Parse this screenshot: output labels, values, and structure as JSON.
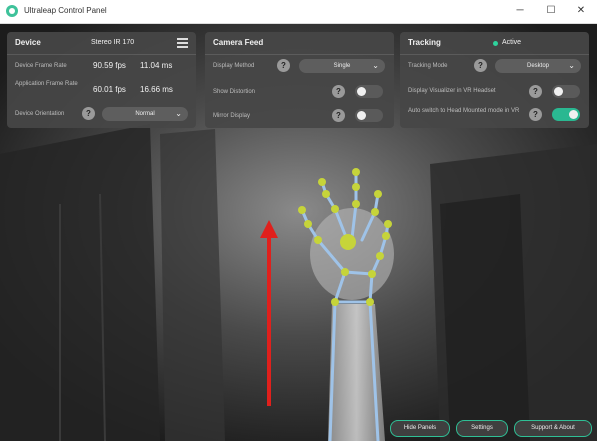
{
  "window": {
    "title": "Ultraleap Control Panel",
    "buttons": {
      "minimize": "─",
      "maximize": "☐",
      "close": "✕"
    }
  },
  "colors": {
    "accent": "#2ab891",
    "panel_bg": "#464646",
    "skeleton_joint": "#c6d43a",
    "arrow": "#e0201c"
  },
  "device_panel": {
    "title": "Device",
    "device_name": "Stereo IR 170",
    "frame_rate_label": "Device Frame Rate",
    "frame_rate_fps": "90.59 fps",
    "frame_rate_ms": "11.04 ms",
    "app_frame_rate_label": "Application Frame Rate",
    "app_frame_rate_fps": "60.01 fps",
    "app_frame_rate_ms": "16.66 ms",
    "orientation_label": "Device Orientation",
    "orientation_value": "Normal",
    "help": "?"
  },
  "camera_panel": {
    "title": "Camera Feed",
    "display_method_label": "Display Method",
    "display_method_value": "Single",
    "show_distortion_label": "Show Distortion",
    "show_distortion_on": false,
    "mirror_display_label": "Mirror Display",
    "mirror_display_on": false,
    "help": "?"
  },
  "tracking_panel": {
    "title": "Tracking",
    "status": "Active",
    "tracking_mode_label": "Tracking Mode",
    "tracking_mode_value": "Desktop",
    "visualizer_label": "Display Visualizer in VR Headset",
    "visualizer_on": false,
    "auto_switch_label": "Auto switch to Head Mounted mode in VR",
    "auto_switch_on": true,
    "help": "?"
  },
  "footer": {
    "hide_panels": "Hide Panels",
    "settings": "Settings",
    "support": "Support & About"
  }
}
